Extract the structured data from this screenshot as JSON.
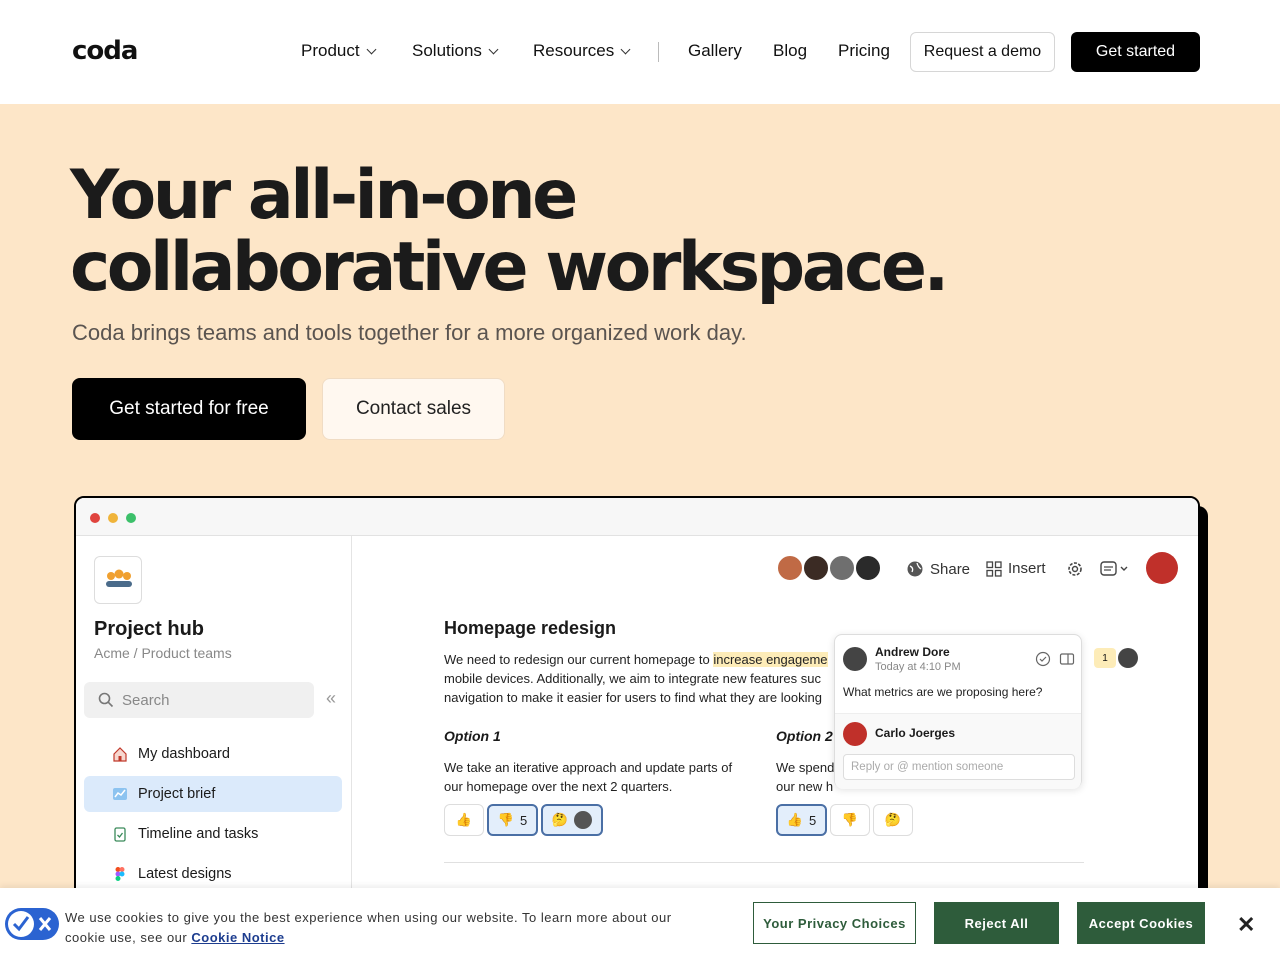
{
  "nav": {
    "logo": "coda",
    "menu": [
      {
        "label": "Product"
      },
      {
        "label": "Solutions"
      },
      {
        "label": "Resources"
      }
    ],
    "links": [
      "Gallery",
      "Blog",
      "Pricing"
    ],
    "demo_label": "Request a demo",
    "start_label": "Get started"
  },
  "hero": {
    "title_line1": "Your all-in-one",
    "title_line2": "collaborative workspace.",
    "subtitle": "Coda brings teams and tools together for a more organized work day.",
    "primary_cta": "Get started for free",
    "secondary_cta": "Contact sales"
  },
  "app": {
    "hub_title": "Project hub",
    "hub_crumb": "Acme / Product teams",
    "search_placeholder": "Search",
    "collapse_icon": "«",
    "sidebar_items": [
      {
        "label": "My dashboard",
        "icon": "house-icon",
        "active": false
      },
      {
        "label": "Project brief",
        "icon": "chart-icon",
        "active": true
      },
      {
        "label": "Timeline and tasks",
        "icon": "clipboard-icon",
        "active": false
      },
      {
        "label": "Latest designs",
        "icon": "figma-icon",
        "active": false
      }
    ],
    "toolbar": {
      "share": "Share",
      "insert": "Insert"
    },
    "doc": {
      "title": "Homepage redesign",
      "para_line1_a": "We need to redesign our current homepage to ",
      "para_line1_hl": "increase engageme",
      "para_line2": "mobile devices. Additionally, we aim to integrate new features suc",
      "para_line3": "navigation to make it easier for users to find what they are looking",
      "option1_title": "Option 1",
      "option1_text": "We take an iterative approach and update parts of our homepage over the next 2 quarters.",
      "option2_title": "Option 2",
      "option2_text_line1": "We spend",
      "option2_text_line2": "our new h",
      "react_count": "5"
    },
    "comment": {
      "author": "Andrew Dore",
      "time": "Today at 4:10 PM",
      "text": "What metrics are we proposing here?",
      "replier": "Carlo Joerges",
      "reply_placeholder": "Reply or @ mention someone",
      "badge_count": "1"
    }
  },
  "cookie": {
    "text": "We use cookies to give you the best experience when using our website. To learn more about our cookie use, see our",
    "link": "Cookie Notice",
    "privacy": "Your Privacy Choices",
    "reject": "Reject All",
    "accept": "Accept Cookies",
    "close": "✕"
  },
  "colors": {
    "hero_bg": "#fde6c8",
    "cookie_green": "#2e5c3b",
    "selection_blue": "#dbeafb"
  }
}
